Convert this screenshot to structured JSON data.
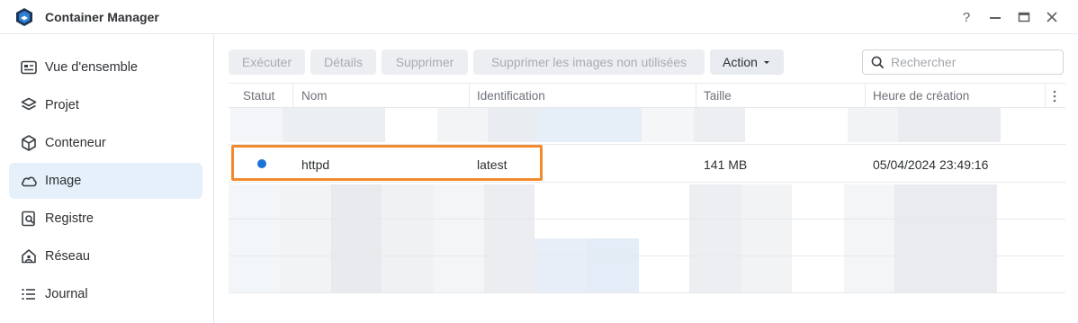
{
  "window": {
    "title": "Container Manager",
    "controls": {
      "help": "?",
      "minimize": "—",
      "maximize": "☐",
      "close": "✕"
    }
  },
  "sidebar": {
    "items": [
      {
        "label": "Vue d'ensemble",
        "icon": "overview-icon",
        "active": false
      },
      {
        "label": "Projet",
        "icon": "project-layers-icon",
        "active": false
      },
      {
        "label": "Conteneur",
        "icon": "container-cube-icon",
        "active": false
      },
      {
        "label": "Image",
        "icon": "cloud-icon",
        "active": true
      },
      {
        "label": "Registre",
        "icon": "registry-search-icon",
        "active": false
      },
      {
        "label": "Réseau",
        "icon": "network-house-icon",
        "active": false
      },
      {
        "label": "Journal",
        "icon": "log-list-icon",
        "active": false
      }
    ]
  },
  "toolbar": {
    "run_label": "Exécuter",
    "details_label": "Détails",
    "delete_label": "Supprimer",
    "delete_unused_label": "Supprimer les images non utilisées",
    "action_label": "Action"
  },
  "search": {
    "placeholder": "Rechercher"
  },
  "table": {
    "headers": [
      "Statut",
      "Nom",
      "Identification",
      "Taille",
      "Heure de création"
    ],
    "rows": [
      {
        "status": "running",
        "name": "httpd",
        "tag": "latest",
        "size": "141 MB",
        "created": "05/04/2024 23:49:16"
      }
    ]
  },
  "colors": {
    "accent": "#1a73d9",
    "highlight": "#f28a2c",
    "active_bg": "#e6f0fb"
  }
}
